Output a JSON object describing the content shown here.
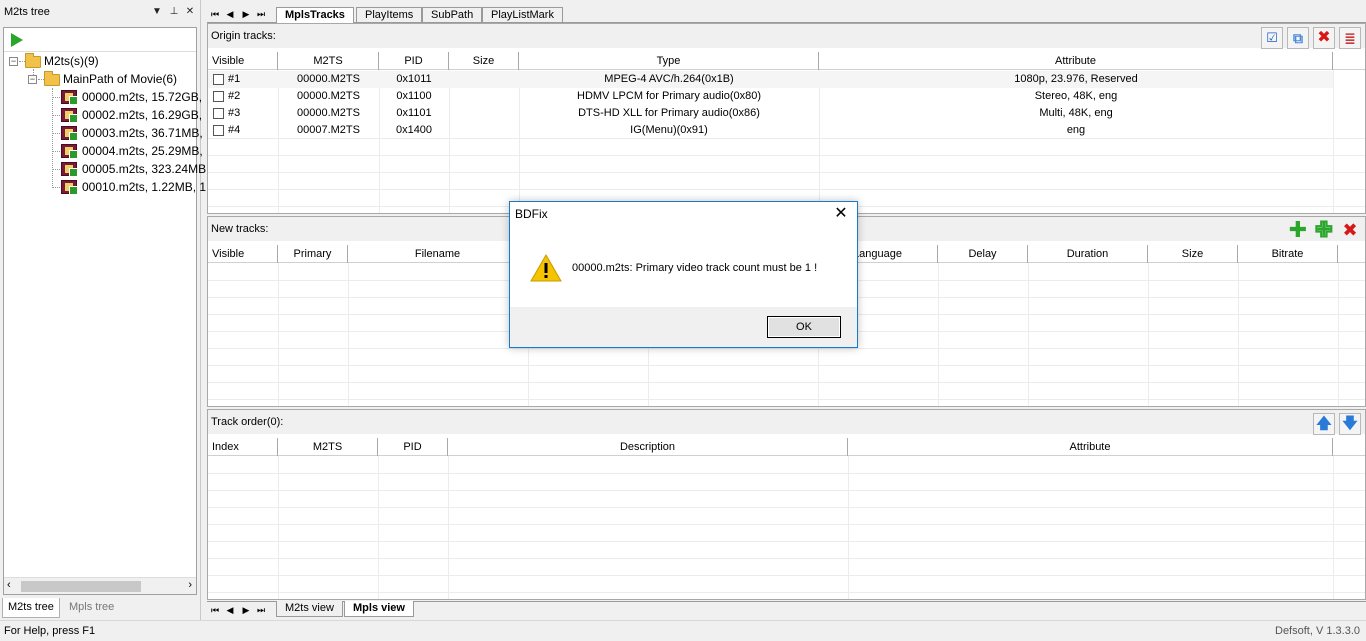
{
  "left_pane": {
    "title": "M2ts tree",
    "tree": {
      "root_label": "M2ts(s)(9)",
      "group_label": "MainPath of Movie(6)",
      "files": [
        "00000.m2ts, 15.72GB,",
        "00002.m2ts, 16.29GB,",
        "00003.m2ts, 36.71MB,",
        "00004.m2ts, 25.29MB,",
        "00005.m2ts, 323.24MB",
        "00010.m2ts, 1.22MB, 1"
      ]
    },
    "bottom_tabs": [
      "M2ts tree",
      "Mpls tree"
    ]
  },
  "top_tabs": [
    "MplsTracks",
    "PlayItems",
    "SubPath",
    "PlayListMark"
  ],
  "origin_tracks": {
    "label": "Origin tracks:",
    "columns": [
      "Visible",
      "M2TS",
      "PID",
      "Size",
      "Type",
      "Attribute"
    ],
    "rows": [
      {
        "visible": "#1",
        "m2ts": "00000.M2TS",
        "pid": "0x1011",
        "size": "",
        "type": "MPEG-4 AVC/h.264(0x1B)",
        "attribute": "1080p, 23.976, Reserved"
      },
      {
        "visible": "#2",
        "m2ts": "00000.M2TS",
        "pid": "0x1100",
        "size": "",
        "type": "HDMV LPCM for Primary audio(0x80)",
        "attribute": "Stereo, 48K, eng"
      },
      {
        "visible": "#3",
        "m2ts": "00000.M2TS",
        "pid": "0x1101",
        "size": "",
        "type": "DTS-HD XLL for Primary audio(0x86)",
        "attribute": "Multi, 48K, eng"
      },
      {
        "visible": "#4",
        "m2ts": "00007.M2TS",
        "pid": "0x1400",
        "size": "",
        "type": "IG(Menu)(0x91)",
        "attribute": "eng"
      }
    ]
  },
  "new_tracks": {
    "label": "New tracks:",
    "columns": [
      "Visible",
      "Primary",
      "Filename",
      "",
      "",
      "Language",
      "Delay",
      "Duration",
      "Size",
      "Bitrate"
    ]
  },
  "track_order": {
    "label": "Track order(0):",
    "columns": [
      "Index",
      "M2TS",
      "PID",
      "Description",
      "Attribute"
    ]
  },
  "bottom_tabs": [
    "M2ts view",
    "Mpls view"
  ],
  "dialog": {
    "title": "BDFix",
    "message": "00000.m2ts: Primary video track count must be 1 !",
    "ok_label": "OK"
  },
  "status": {
    "help": "For Help, press F1",
    "version": "Defsoft, V 1.3.3.0"
  },
  "colors": {
    "dialog_border": "#1979ca",
    "add_icon": "#2aa62a",
    "remove_icon": "#d81818",
    "arrow_icon": "#2a7ad8"
  }
}
